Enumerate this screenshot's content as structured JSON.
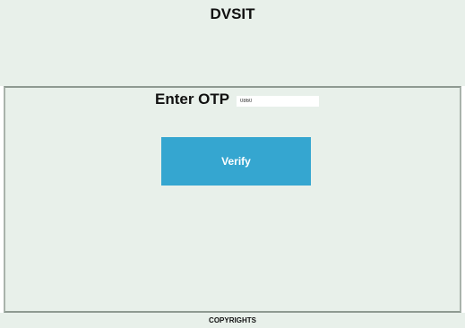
{
  "header": {
    "title": "DVSIT"
  },
  "main": {
    "otp_label": "Enter OTP",
    "otp_value": "0860",
    "verify_label": "Verify"
  },
  "footer": {
    "text": "COPYRIGHTS"
  },
  "colors": {
    "background": "#e8f0ea",
    "button": "#35a6d0",
    "button_text": "#ffffff"
  }
}
